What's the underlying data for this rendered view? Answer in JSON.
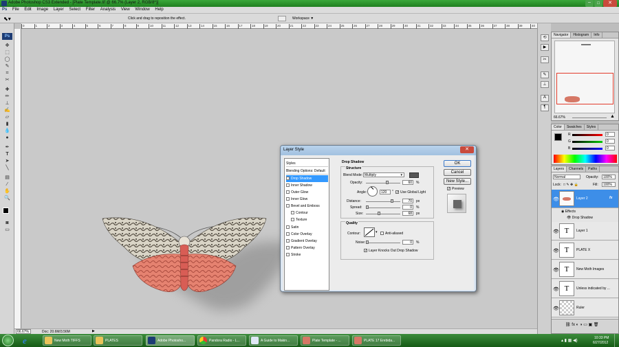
{
  "window": {
    "title": "Adobe Photoshop CS3 Extended - [Plate Template.tif @ 66.7% (Layer 2, RGB/8*)]"
  },
  "menu": [
    "File",
    "Edit",
    "Image",
    "Layer",
    "Select",
    "Filter",
    "Analysis",
    "View",
    "Window",
    "Help"
  ],
  "options": {
    "hint": "Click and drag to reposition the effect.",
    "workspace": "Workspace ▼"
  },
  "ruler": [
    "0",
    "1",
    "2",
    "3",
    "4",
    "5",
    "6",
    "7",
    "8",
    "9",
    "10",
    "11",
    "12",
    "13",
    "14",
    "15",
    "16",
    "17",
    "18",
    "19",
    "20",
    "21",
    "22",
    "23",
    "24",
    "25",
    "26",
    "27",
    "28",
    "29",
    "30",
    "31",
    "32",
    "33",
    "34",
    "35",
    "36",
    "37",
    "38",
    "39",
    "40"
  ],
  "status": {
    "zoom": "66.67%",
    "doc": "Doc: 20.6M/3.56M"
  },
  "navigator": {
    "tabs": [
      "Navigator",
      "Histogram",
      "Info"
    ],
    "zoom": "66.67%"
  },
  "color": {
    "tabs": [
      "Color",
      "Swatches",
      "Styles"
    ],
    "r": "R",
    "g": "G",
    "b": "B",
    "rv": "0",
    "gv": "0",
    "bv": "0"
  },
  "layers": {
    "tabs": [
      "Layers",
      "Channels",
      "Paths"
    ],
    "blend": "Normal",
    "opacity_label": "Opacity:",
    "opacity": "100%",
    "lock_label": "Lock:",
    "fill_label": "Fill:",
    "fill": "100%",
    "selected": "Layer 2",
    "effects": "Effects",
    "drop_shadow": "Drop Shadow",
    "items": [
      "Layer 1",
      "PLATE X",
      "New Moth Images",
      "Unless indicated by ...",
      "Ruler"
    ]
  },
  "dialog": {
    "title": "Layer Style",
    "list_header": "Styles",
    "blending": "Blending Options: Default",
    "styles": [
      "Drop Shadow",
      "Inner Shadow",
      "Outer Glow",
      "Inner Glow",
      "Bevel and Emboss",
      "Contour",
      "Texture",
      "Satin",
      "Color Overlay",
      "Gradient Overlay",
      "Pattern Overlay",
      "Stroke"
    ],
    "section": "Drop Shadow",
    "structure": "Structure",
    "blend_mode_label": "Blend Mode:",
    "blend_mode": "Multiply",
    "opacity_label": "Opacity:",
    "opacity": "60",
    "opacity_unit": "%",
    "angle_label": "Angle:",
    "angle": "120",
    "angle_unit": "°",
    "global_light": "Use Global Light",
    "distance_label": "Distance:",
    "distance": "70",
    "spread_label": "Spread:",
    "spread": "0",
    "size_label": "Size:",
    "size": "68",
    "px": "px",
    "pct": "%",
    "quality": "Quality",
    "contour_label": "Contour:",
    "anti_aliased": "Anti-aliased",
    "noise_label": "Noise:",
    "noise": "0",
    "knockout": "Layer Knocks Out Drop Shadow",
    "ok": "OK",
    "cancel": "Cancel",
    "new_style": "New Style...",
    "preview": "Preview"
  },
  "taskbar": {
    "items": [
      "New Moth TIFFS",
      "PLATES",
      "Adobe Photosho...",
      "Pandora Radio - L...",
      "A Guide to Makin...",
      "Plate Template - ...",
      "PLATE 17 Erebida..."
    ],
    "time": "10:33 PM",
    "date": "6/27/2012"
  },
  "colors": {
    "accent": "#3399ff",
    "titlebar": "#2a8f2a",
    "shadow_color": "#555555"
  }
}
